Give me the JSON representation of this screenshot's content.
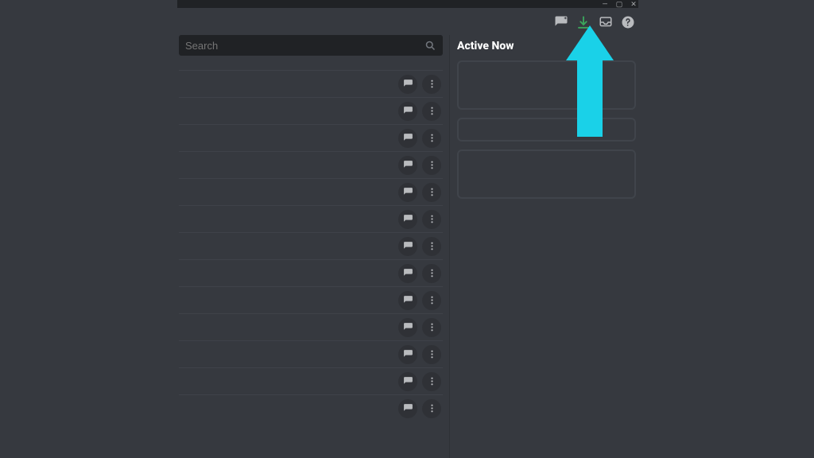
{
  "window": {
    "minimize": "—",
    "maximize": "▢",
    "close": "✕"
  },
  "toolbar": {
    "new_dm_icon": "new-group-dm",
    "download_icon": "download",
    "inbox_icon": "inbox",
    "help_icon": "help"
  },
  "search": {
    "placeholder": "Search",
    "value": ""
  },
  "friends": {
    "rows": [
      {
        "id": 1
      },
      {
        "id": 2
      },
      {
        "id": 3
      },
      {
        "id": 4
      },
      {
        "id": 5
      },
      {
        "id": 6
      },
      {
        "id": 7
      },
      {
        "id": 8
      },
      {
        "id": 9
      },
      {
        "id": 10
      },
      {
        "id": 11
      },
      {
        "id": 12
      },
      {
        "id": 13
      }
    ],
    "message_action": "Message",
    "more_action": "More"
  },
  "active_now": {
    "title": "Active Now",
    "cards": [
      {
        "size": "tall"
      },
      {
        "size": "short"
      },
      {
        "size": "tall"
      }
    ]
  },
  "colors": {
    "accent_arrow": "#1ad1e8",
    "download_green": "#3ba55c"
  }
}
